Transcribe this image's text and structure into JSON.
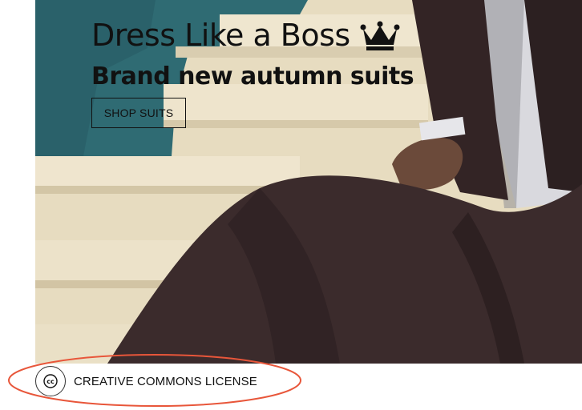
{
  "hero": {
    "headline": "Dress Like a Boss",
    "headline_icon": "crown-icon",
    "subheadline": "Brand new autumn suits",
    "cta_label": "SHOP SUITS"
  },
  "footer": {
    "license_icon": "creative-commons-icon",
    "license_label": "CREATIVE COMMONS LICENSE"
  },
  "colors": {
    "text": "#111111",
    "annotation": "#e8563a",
    "wall_teal": "#2f6b73",
    "suit": "#3a2a2b",
    "steps": "#e9dfc5"
  }
}
